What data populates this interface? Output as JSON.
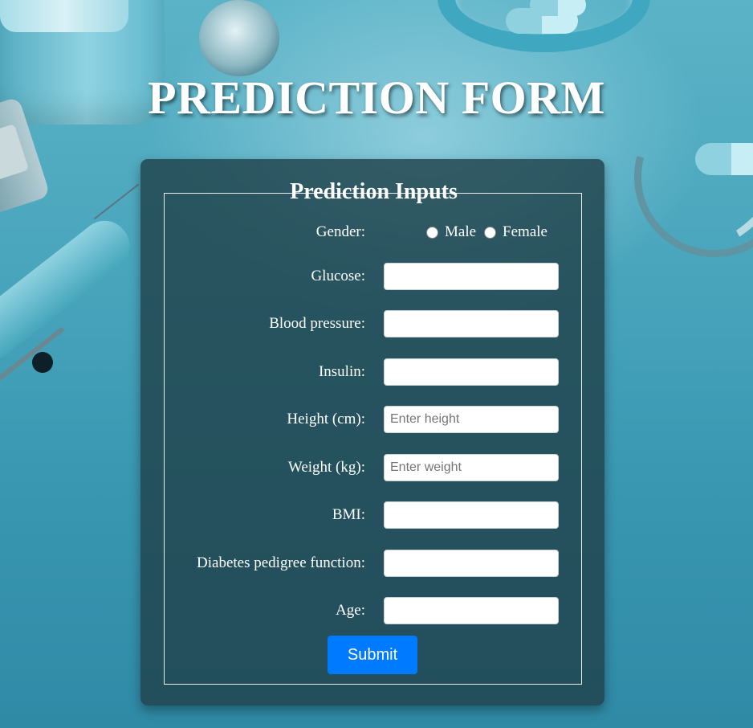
{
  "page": {
    "title": "PREDICTION FORM"
  },
  "form": {
    "legend": "Prediction Inputs",
    "gender": {
      "label": "Gender:",
      "options": [
        "Male",
        "Female"
      ]
    },
    "fields": [
      {
        "label": "Glucose:",
        "value": "",
        "placeholder": ""
      },
      {
        "label": "Blood pressure:",
        "value": "",
        "placeholder": ""
      },
      {
        "label": "Insulin:",
        "value": "",
        "placeholder": ""
      },
      {
        "label": "Height (cm):",
        "value": "",
        "placeholder": "Enter height"
      },
      {
        "label": "Weight (kg):",
        "value": "",
        "placeholder": "Enter weight"
      },
      {
        "label": "BMI:",
        "value": "",
        "placeholder": ""
      },
      {
        "label": "Diabetes pedigree function:",
        "value": "",
        "placeholder": ""
      },
      {
        "label": "Age:",
        "value": "",
        "placeholder": ""
      }
    ],
    "submit_label": "Submit"
  },
  "colors": {
    "accent": "#007bff",
    "panel": "#20424a",
    "text": "#ffffff"
  }
}
